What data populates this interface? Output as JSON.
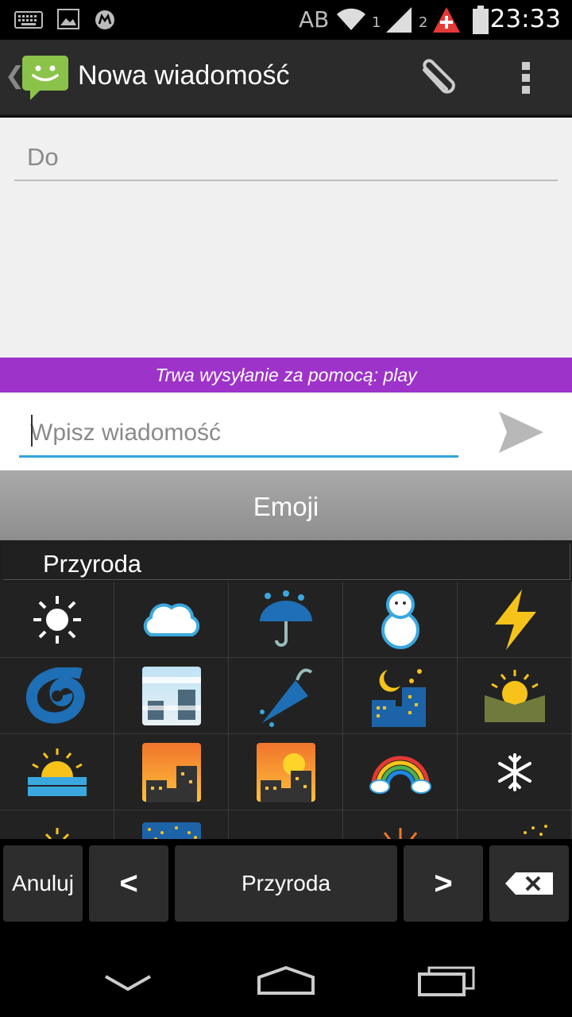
{
  "status_bar": {
    "network_label": "AB",
    "sim1": "1",
    "sim2": "2",
    "time": "23:33"
  },
  "action_bar": {
    "title": "Nowa wiadomość"
  },
  "compose": {
    "to_placeholder": "Do",
    "sending_banner": "Trwa wysyłanie za pomocą: play",
    "message_placeholder": "Wpisz wiadomość"
  },
  "emoji_keyboard": {
    "header": "Emoji",
    "category": "Przyroda",
    "emojis": [
      [
        "sun",
        "cloud",
        "umbrella-rain",
        "snowman",
        "lightning"
      ],
      [
        "cyclone",
        "foggy",
        "closed-umbrella",
        "night-stars",
        "sunrise-mountains"
      ],
      [
        "sunrise",
        "city-dusk",
        "city-sunset",
        "rainbow",
        "snowflake"
      ],
      [
        "sun-partial",
        "night-city-partial",
        "empty",
        "fireworks-partial",
        "sparkler-partial"
      ]
    ],
    "bottom_keys": {
      "cancel": "Anuluj",
      "prev": "<",
      "category": "Przyroda",
      "next": ">"
    }
  },
  "colors": {
    "accent_purple": "#9d33c9",
    "input_underline": "#33a5d8",
    "sms_green": "#8bc34a"
  }
}
